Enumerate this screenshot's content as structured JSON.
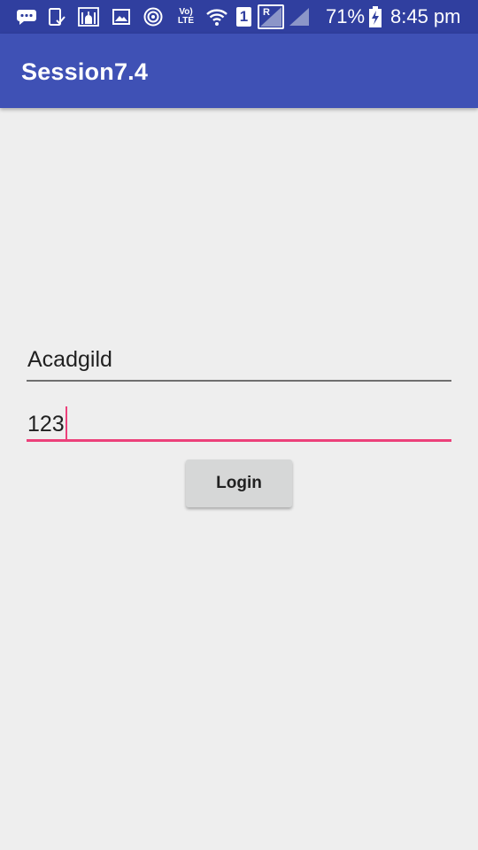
{
  "status_bar": {
    "icons": [
      "chat-bubble-icon",
      "phone-check-icon",
      "mosque-icon",
      "gallery-icon",
      "target-icon",
      "volte-icon",
      "wifi-icon",
      "sim-one-icon",
      "roaming-icon",
      "cellular-signal-icon",
      "battery-charging-icon"
    ],
    "volte_top": "Vo)",
    "volte_bottom": "LTE",
    "sim_number": "1",
    "roaming_letter": "R",
    "battery_percent": "71%",
    "time": "8:45 pm"
  },
  "app_bar": {
    "title": "Session7.4"
  },
  "form": {
    "username_value": "Acadgild",
    "password_value": "123",
    "login_label": "Login"
  },
  "colors": {
    "status_bar": "#303f9f",
    "app_bar": "#3f51b5",
    "background": "#eeeeee",
    "accent": "#ec407a",
    "button": "#d6d7d7"
  }
}
